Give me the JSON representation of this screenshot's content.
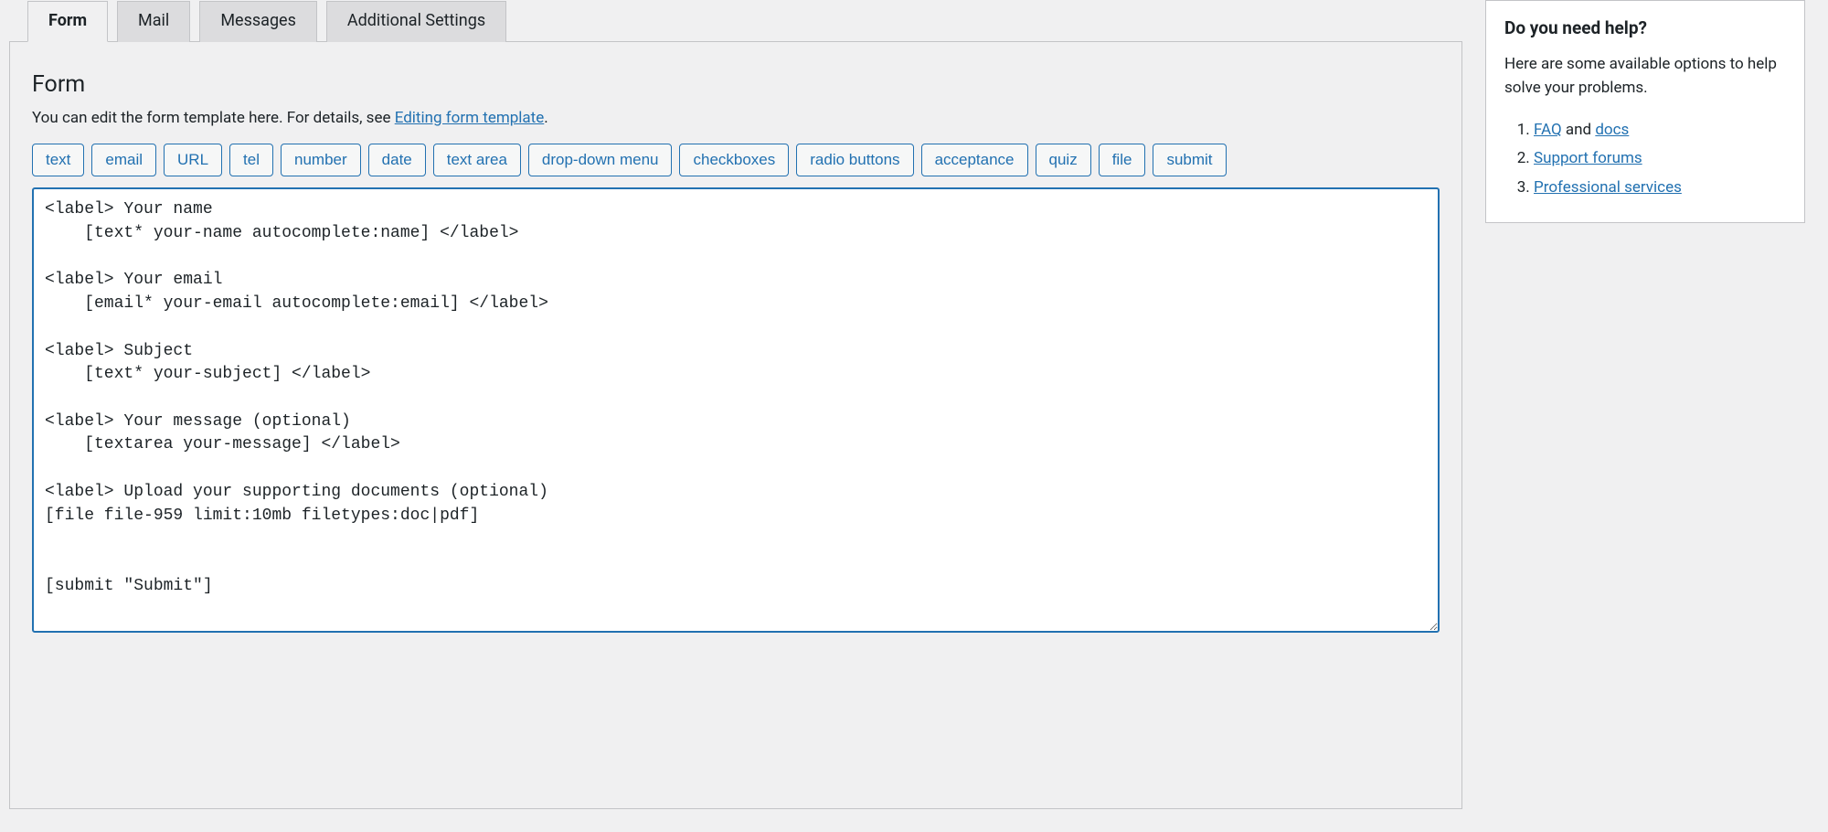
{
  "tabs": [
    {
      "label": "Form",
      "active": true
    },
    {
      "label": "Mail",
      "active": false
    },
    {
      "label": "Messages",
      "active": false
    },
    {
      "label": "Additional Settings",
      "active": false
    }
  ],
  "panel": {
    "heading": "Form",
    "desc_prefix": "You can edit the form template here. For details, see ",
    "desc_link": "Editing form template",
    "desc_suffix": "."
  },
  "tag_buttons": [
    "text",
    "email",
    "URL",
    "tel",
    "number",
    "date",
    "text area",
    "drop-down menu",
    "checkboxes",
    "radio buttons",
    "acceptance",
    "quiz",
    "file",
    "submit"
  ],
  "form_template": "<label> Your name\n    [text* your-name autocomplete:name] </label>\n\n<label> Your email\n    [email* your-email autocomplete:email] </label>\n\n<label> Subject\n    [text* your-subject] </label>\n\n<label> Your message (optional)\n    [textarea your-message] </label>\n\n<label> Upload your supporting documents (optional)\n[file file-959 limit:10mb filetypes:doc|pdf]\n\n\n[submit \"Submit\"]",
  "help": {
    "title": "Do you need help?",
    "intro": "Here are some available options to help solve your problems.",
    "items": [
      {
        "link": "FAQ",
        "after": " and ",
        "link2": "docs"
      },
      {
        "link": "Support forums"
      },
      {
        "link": "Professional services"
      }
    ]
  }
}
